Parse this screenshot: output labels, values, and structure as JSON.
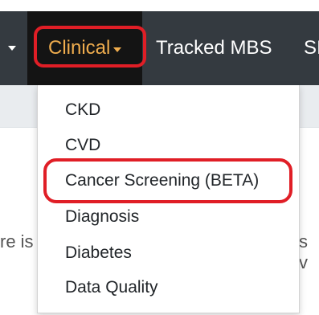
{
  "navbar": {
    "items": [
      {
        "label": "Clinical"
      },
      {
        "label": "Tracked MBS"
      },
      {
        "label": "SI"
      }
    ]
  },
  "dropdown": {
    "items": [
      {
        "label": "CKD"
      },
      {
        "label": "CVD"
      },
      {
        "label": "Cancer Screening (BETA)"
      },
      {
        "label": "Diagnosis"
      },
      {
        "label": "Diabetes"
      },
      {
        "label": "Data Quality"
      }
    ]
  },
  "background": {
    "left_fragment": "re is",
    "right_fragment": "s v"
  },
  "colors": {
    "navbar_bg": "#343a40",
    "active_bg": "#141414",
    "active_text": "#f0ad4e",
    "highlight": "#e01e26"
  }
}
